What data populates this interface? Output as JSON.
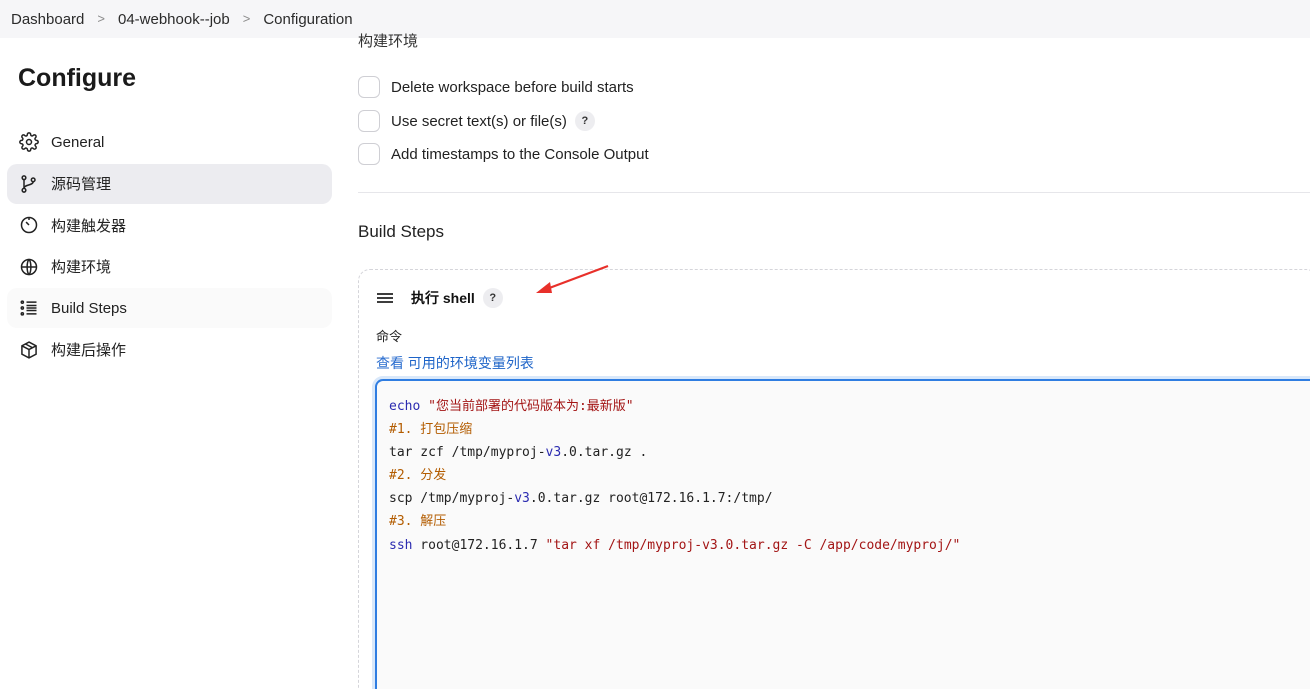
{
  "breadcrumb": {
    "items": [
      "Dashboard",
      "04-webhook--job",
      "Configuration"
    ],
    "separator": ">"
  },
  "sidebar": {
    "title": "Configure",
    "items": [
      {
        "label": "General",
        "icon": "gear-icon"
      },
      {
        "label": "源码管理",
        "icon": "git-branch-icon",
        "active": true
      },
      {
        "label": "构建触发器",
        "icon": "timer-icon"
      },
      {
        "label": "构建环境",
        "icon": "globe-icon"
      },
      {
        "label": "Build Steps",
        "icon": "list-icon"
      },
      {
        "label": "构建后操作",
        "icon": "package-icon"
      }
    ]
  },
  "main": {
    "top_section_label": "构建环境",
    "options": [
      {
        "label": "Delete workspace before build starts",
        "checked": false
      },
      {
        "label": "Use secret text(s) or file(s)",
        "checked": false,
        "help": "?"
      },
      {
        "label": "Add timestamps to the Console Output",
        "checked": false
      }
    ],
    "build_steps_title": "Build Steps",
    "step": {
      "title": "执行 shell",
      "help": "?",
      "command_label": "命令",
      "env_prefix": "查看",
      "env_link": "可用的环境变量列表",
      "code": [
        {
          "parts": [
            {
              "t": "echo",
              "c": "kw"
            },
            {
              "t": " "
            },
            {
              "t": "\"您当前部署的代码版本为:最新版\"",
              "c": "str"
            }
          ]
        },
        {
          "parts": [
            {
              "t": "#1. 打包压缩",
              "c": "cmt"
            }
          ]
        },
        {
          "parts": [
            {
              "t": "tar zcf /tmp/myproj-"
            },
            {
              "t": "v3",
              "c": "num"
            },
            {
              "t": ".0.tar.gz ."
            }
          ]
        },
        {
          "parts": [
            {
              "t": "#2. 分发",
              "c": "cmt"
            }
          ]
        },
        {
          "parts": [
            {
              "t": "scp /tmp/myproj-"
            },
            {
              "t": "v3",
              "c": "num"
            },
            {
              "t": ".0.tar.gz root@172.16.1.7:/tmp/"
            }
          ]
        },
        {
          "parts": [
            {
              "t": "#3. 解压",
              "c": "cmt"
            }
          ]
        },
        {
          "parts": [
            {
              "t": "ssh",
              "c": "kw"
            },
            {
              "t": " root@172.16.1.7 "
            },
            {
              "t": "\"tar xf /tmp/myproj-v3.0.tar.gz -C /app/code/myproj/\"",
              "c": "str"
            }
          ]
        }
      ]
    }
  },
  "colors": {
    "accent": "#2f7de1",
    "link": "#1e64c8",
    "annotation_arrow": "#e8302a"
  }
}
